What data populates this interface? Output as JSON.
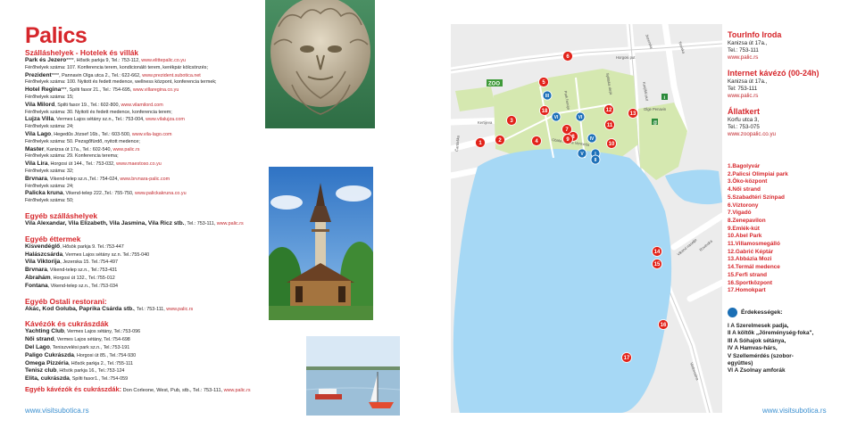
{
  "left": {
    "title": "Palics",
    "hotels_heading": "Szálláshelyek - Hotelek és villák",
    "hotels": [
      {
        "name": "Park és Jezero",
        "rest": "****, Hősök parkja 9, Tel.: 753-112,",
        "url": "www.elittepalic.co.yu"
      },
      {
        "name": "",
        "rest": "Férőhelyek száma: 107. Konferencia terem, kondicionáló terem, kerékpár kölcsönzés;",
        "url": ""
      },
      {
        "name": "Prezident",
        "rest": "****, Pannavin Olga utca 2., Tel.: 622-662,",
        "url": "www.prezident.subotica.net"
      },
      {
        "name": "",
        "rest": "Férőhelyek száma: 100. Nyitott és fedett medence, wellness központ, konferencia termek;",
        "url": ""
      },
      {
        "name": "Hotel Regina",
        "rest": "***, Spilti fasor 21., Tel.: 754-695,",
        "url": "www.villaregina.co.yu"
      },
      {
        "name": "",
        "rest": "Férőhelyek száma: 15;",
        "url": ""
      },
      {
        "name": "Vila Milord",
        "rest": ", Spilti fasor 19., Tel.: 602-800,",
        "url": "www.vilamilord.com"
      },
      {
        "name": "",
        "rest": "Férőhelyek száma: 30. Nyitott és fedett medence, konferencia terem;",
        "url": ""
      },
      {
        "name": "Lujza Villa",
        "rest": ", Vermes Lajos sétány sz.n., Tel.: 753-004,",
        "url": "www.vilalujza.com"
      },
      {
        "name": "",
        "rest": "Férőhelyek száma: 24;",
        "url": ""
      },
      {
        "name": "Vila Lago",
        "rest": ", Hegedűs József 16b., Tel.: 603-500,",
        "url": "www.vila-lago.com"
      },
      {
        "name": "",
        "rest": "Férőhelyek száma: 50. Pezsgőfürdő, nyitott medence;",
        "url": ""
      },
      {
        "name": "Master",
        "rest": ", Kanizsa út 17a., Tel.: 602-540,",
        "url": "www.palic.rs"
      },
      {
        "name": "",
        "rest": "Férőhelyek száma: 29. Konferencia terema;",
        "url": ""
      },
      {
        "name": "Vila Lira",
        "rest": ", Horgosi út 144., Tel.: 753-032,",
        "url": "www.maestoso.co.yu"
      },
      {
        "name": "",
        "rest": "Férőhelyek száma: 32;",
        "url": ""
      },
      {
        "name": "Brvnara",
        "rest": ", Vikend-telep sz.n.,Tel.: 754-024,",
        "url": "www.brvnara-palic.com"
      },
      {
        "name": "",
        "rest": "Férőhelyek száma: 24;",
        "url": ""
      },
      {
        "name": "Palicka kruna",
        "rest": ", Vikend-telep 222.,Tel.: 755-750,",
        "url": "www.palickakruna.co.yu"
      },
      {
        "name": "",
        "rest": "Férőhelyek száma: 50;",
        "url": ""
      }
    ],
    "other_lodging_heading": "Egyéb szálláshelyek",
    "other_lodging": [
      {
        "name": "Vila Alexandar, Vila Elizabeth, Vila Jasmina, Vila Ricz stb.",
        "rest": ", Tel.: 753-111,",
        "url": "www.palic.rs"
      }
    ],
    "restaurants_heading": "Egyéb éttermek",
    "restaurants": [
      {
        "name": "Kisvendéglő",
        "rest": ", Hősök parkja 9. Tel.:753-447",
        "url": ""
      },
      {
        "name": "Halászcsárda",
        "rest": ", Vermes Lajos sétány sz.n. Tel.:755-040",
        "url": ""
      },
      {
        "name": "Vila Viktorija",
        "rest": ", Jezerska 15. Tel.:754-497",
        "url": ""
      },
      {
        "name": "Brvnara",
        "rest": ", Vikend-telep sz.n., Tel.:753-431",
        "url": ""
      },
      {
        "name": "Ábrahám",
        "rest": ", Horgosi út 132., Tel.:755-012",
        "url": ""
      },
      {
        "name": "Fontana",
        "rest": ", Vikend-telep sz.n., Tel.:753-034",
        "url": ""
      }
    ],
    "other_rest_heading": "Egyéb Ostali restorani:",
    "other_rest": [
      {
        "name": "Akác, Kod Goluba, Paprika Csárda stb.",
        "rest": ", Tel.: 753-111,",
        "url": "www.palic.rs"
      }
    ],
    "cafes_heading": "Kávézók és cukrászdák",
    "cafes": [
      {
        "name": "Yachting Club",
        "rest": ", Vermes Lajos sétány, Tel.:753-096",
        "url": ""
      },
      {
        "name": "Női strand",
        "rest": ", Vermes Lajos sétány, Tel.:754-698",
        "url": ""
      },
      {
        "name": "Del Lago",
        "rest": ", Teniszvelési park sz.n., Tel.:753-191",
        "url": ""
      },
      {
        "name": "Paligo Cukrászda",
        "rest": ", Horgosi út 85., Tel.:754-930",
        "url": ""
      },
      {
        "name": "Omega Pizzéria",
        "rest": ", Hősök parkja 2., Tel.:755-111",
        "url": ""
      },
      {
        "name": "Tenisz club",
        "rest": ", Hősök parkja 16., Tel.:753-124",
        "url": ""
      },
      {
        "name": "Elita, cukrászda",
        "rest": ", Spilti fasor1., Tel.:754-059",
        "url": ""
      }
    ],
    "other_cafes_heading": "Egyéb kávézók és cukrászdák:",
    "other_cafes_rest": " Don Corleone, West, Pub, stb., Tel.: 753-111,",
    "other_cafes_url": "www.palic.rs"
  },
  "right": {
    "tourinfo": {
      "heading": "TourInfo Iroda",
      "addr": "Kanizsa út 17a.,",
      "tel": "Tel.: 753-111",
      "url": "www.palic.rs"
    },
    "internet": {
      "heading": "Internet kávézó (00-24h)",
      "addr": "Kanizsa út 17a.,",
      "tel": "Tel: 753-111",
      "url": "www.palic.rs"
    },
    "zoo": {
      "heading": "Állatkert",
      "addr": "Korfu utca 3,",
      "tel": "Tel.: 753-075",
      "url": "www.zoopalic.co.yu"
    },
    "legend": [
      "1.Bagolyvár",
      "2.Palicsi Olimpiai park",
      "3.Öko-központ",
      "4.Női strand",
      "5.Szabadtéri Színpad",
      "6.Víztorony",
      "7.Vigadó",
      "8.Zenepavilon",
      "9.Emlék-kút",
      "10.Abel Park",
      "11.Villamosmegálló",
      "12.Gabrić Képtár",
      "13.Abbázia Mozi",
      "14.Termál medence",
      "15.Ferfi strand",
      "16.Sportközpont",
      "17.Homokpart"
    ],
    "sights_heading": "Érdekességek:",
    "sights": [
      "I A Szerelmesek padja,",
      "II A költők „Jöreménység-foka\",",
      "III A Sóhajok sétánya,",
      "IV A Hamvas-hárs,",
      "V Szellemérdés (szobor-",
      "együttes)",
      "VI A Zsolnay amforák"
    ]
  },
  "map": {
    "numbers": [
      "1",
      "2",
      "3",
      "4",
      "5",
      "6",
      "7",
      "8",
      "9",
      "10",
      "11",
      "12",
      "13",
      "14",
      "15",
      "16",
      "17",
      "18"
    ],
    "romans": [
      "I",
      "II",
      "III",
      "IV",
      "V",
      "VI",
      "VI"
    ],
    "zoo_label": "ZOO",
    "streets": [
      "Horgosi put",
      "Kanjiški put",
      "Jezerska",
      "Teniska",
      "Olge Penavin",
      "Splitska aleja",
      "Park heroja",
      "Obala Lajoša Vermeša",
      "Kertijeva",
      "Vikend naselje",
      "Rovinska",
      "Vodovodna",
      "Čardaška",
      "Trg",
      "Korla",
      "Njvmetova",
      "Bajmok",
      "Narodni heroja"
    ]
  },
  "footer": {
    "left": "www.visitsubotica.rs",
    "right": "www.visitsubotica.rs"
  },
  "colors": {
    "accent": "#d6262b",
    "link": "#c2272d",
    "lake": "#a6d8f5",
    "park": "#d5e8b0",
    "marker": "#e2231a",
    "sight": "#1d70b8"
  }
}
